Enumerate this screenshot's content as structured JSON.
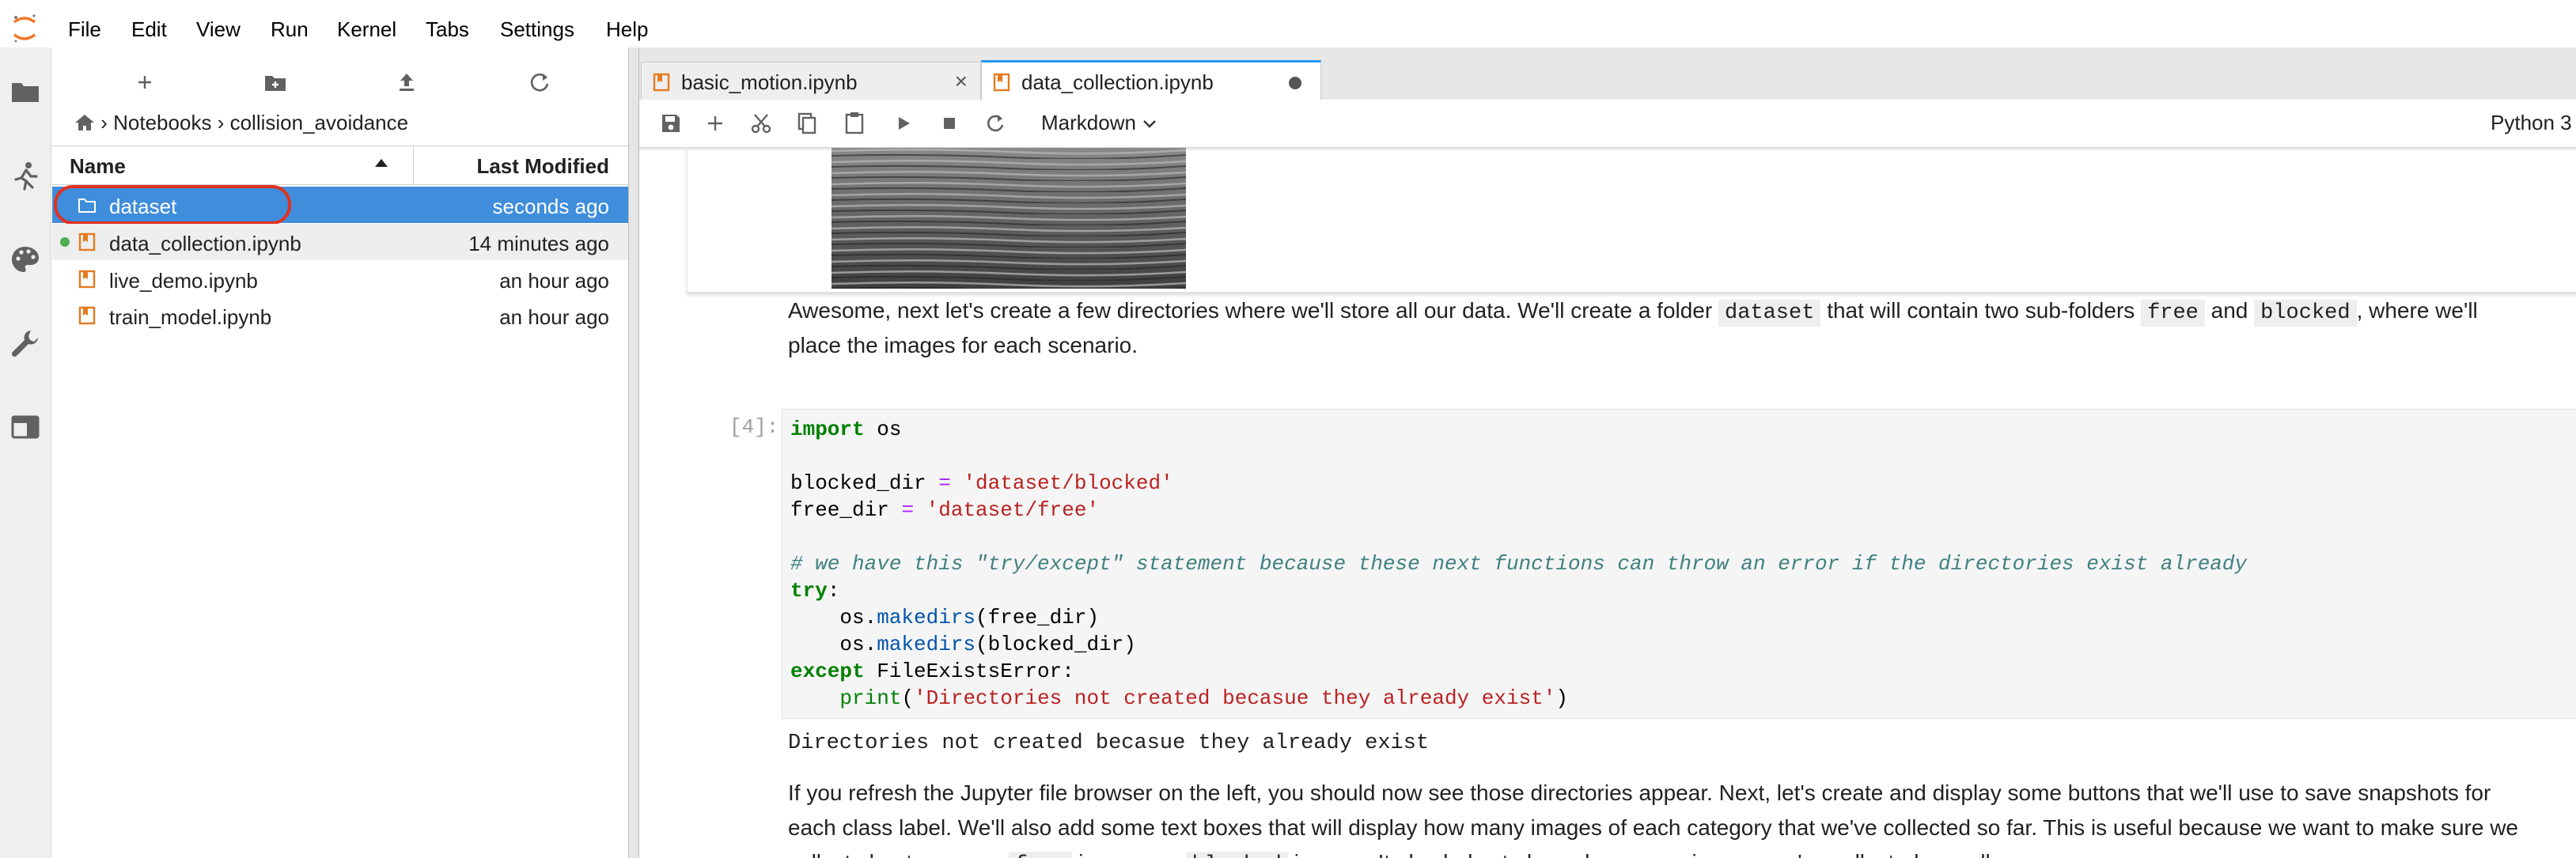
{
  "menubar": {
    "items": [
      "File",
      "Edit",
      "View",
      "Run",
      "Kernel",
      "Tabs",
      "Settings",
      "Help"
    ]
  },
  "activitybar": {
    "icons": [
      "folder-icon",
      "running-icon",
      "palette-icon",
      "wrench-icon",
      "tabs-icon"
    ]
  },
  "filebrowser": {
    "breadcrumb": {
      "home_icon": "home-icon",
      "parts": [
        "Notebooks",
        "collision_avoidance"
      ],
      "separator": "›"
    },
    "columns": {
      "name": "Name",
      "modified": "Last Modified"
    },
    "items": [
      {
        "name": "dataset",
        "modified": "seconds ago",
        "type": "folder",
        "selected": true,
        "running": false
      },
      {
        "name": "data_collection.ipynb",
        "modified": "14 minutes ago",
        "type": "notebook",
        "selected": false,
        "running": true
      },
      {
        "name": "live_demo.ipynb",
        "modified": "an hour ago",
        "type": "notebook",
        "selected": false,
        "running": false
      },
      {
        "name": "train_model.ipynb",
        "modified": "an hour ago",
        "type": "notebook",
        "selected": false,
        "running": false
      }
    ]
  },
  "tabs": [
    {
      "label": "basic_motion.ipynb",
      "active": false
    },
    {
      "label": "data_collection.ipynb",
      "active": true
    }
  ],
  "toolbar": {
    "cell_type": "Markdown",
    "kernel": "Python 3"
  },
  "notebook": {
    "md1": {
      "l1_a": "Awesome, next let's create a few directories where we'll store all our data. We'll create a folder ",
      "l1_code1": "dataset",
      "l1_b": " that will contain two sub-folders ",
      "l1_code2": "free",
      "l1_c": " and ",
      "l1_code3": "blocked",
      "l1_d": ", where we'll",
      "l2": "place the images for each scenario."
    },
    "cell": {
      "prompt": "[4]:",
      "import_kw": "import",
      "import_mod": " os",
      "blocked_var": "blocked_dir ",
      "eq": "=",
      "blocked_val": " 'dataset/blocked'",
      "free_var": "free_dir ",
      "free_val": " 'dataset/free'",
      "comment": "# we have this \"try/except\" statement because these next functions can throw an error if the directories exist already",
      "try_kw": "try",
      "colon": ":",
      "os_prefix": "    os.",
      "makedirs": "makedirs",
      "arg_free": "(free_dir)",
      "arg_blocked": "(blocked_dir)",
      "except_kw": "except",
      "except_rest": " FileExistsError:",
      "indent": "    ",
      "print_fn": "print",
      "print_open": "(",
      "print_str": "'Directories not created becasue they already exist'",
      "print_close": ")"
    },
    "output": "Directories not created becasue they already exist",
    "md2": {
      "l1": "If you refresh the Jupyter file browser on the left, you should now see those directories appear. Next, let's create and display some buttons that we'll use to save snapshots for",
      "l2": "each class label. We'll also add some text boxes that will display how many images of each category that we've collected so far. This is useful because we want to make sure we",
      "l3_a": "collect about as many ",
      "l3_code1": "free",
      "l3_b": " images as ",
      "l3_code2": "blocked",
      "l3_c": " images. It also helps to know how many images we've collected overall."
    }
  },
  "colors": {
    "selection": "#3f8ddb",
    "highlight_circle": "#e0321f",
    "active_tab_accent": "#2196f3",
    "notebook_icon": "#e57a1e",
    "running_dot": "#4caf50"
  }
}
